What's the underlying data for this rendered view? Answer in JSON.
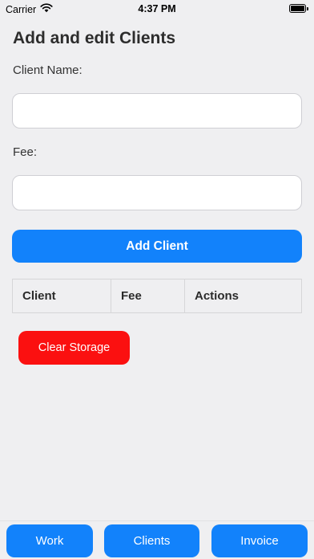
{
  "status_bar": {
    "carrier": "Carrier",
    "time": "4:37 PM",
    "icons": [
      "wifi-icon",
      "battery-icon"
    ]
  },
  "page": {
    "title": "Add and edit Clients"
  },
  "form": {
    "client_name_label": "Client Name:",
    "client_name_value": "",
    "client_name_placeholder": "",
    "fee_label": "Fee:",
    "fee_value": "",
    "fee_placeholder": "",
    "add_button_label": "Add Client"
  },
  "table": {
    "columns": [
      "Client",
      "Fee",
      "Actions"
    ],
    "rows": []
  },
  "clear_storage_label": "Clear Storage",
  "tabs": [
    {
      "label": "Work"
    },
    {
      "label": "Clients"
    },
    {
      "label": "Invoice"
    }
  ],
  "colors": {
    "accent": "#1282fb",
    "danger": "#fb1010",
    "background": "#efeff1"
  }
}
